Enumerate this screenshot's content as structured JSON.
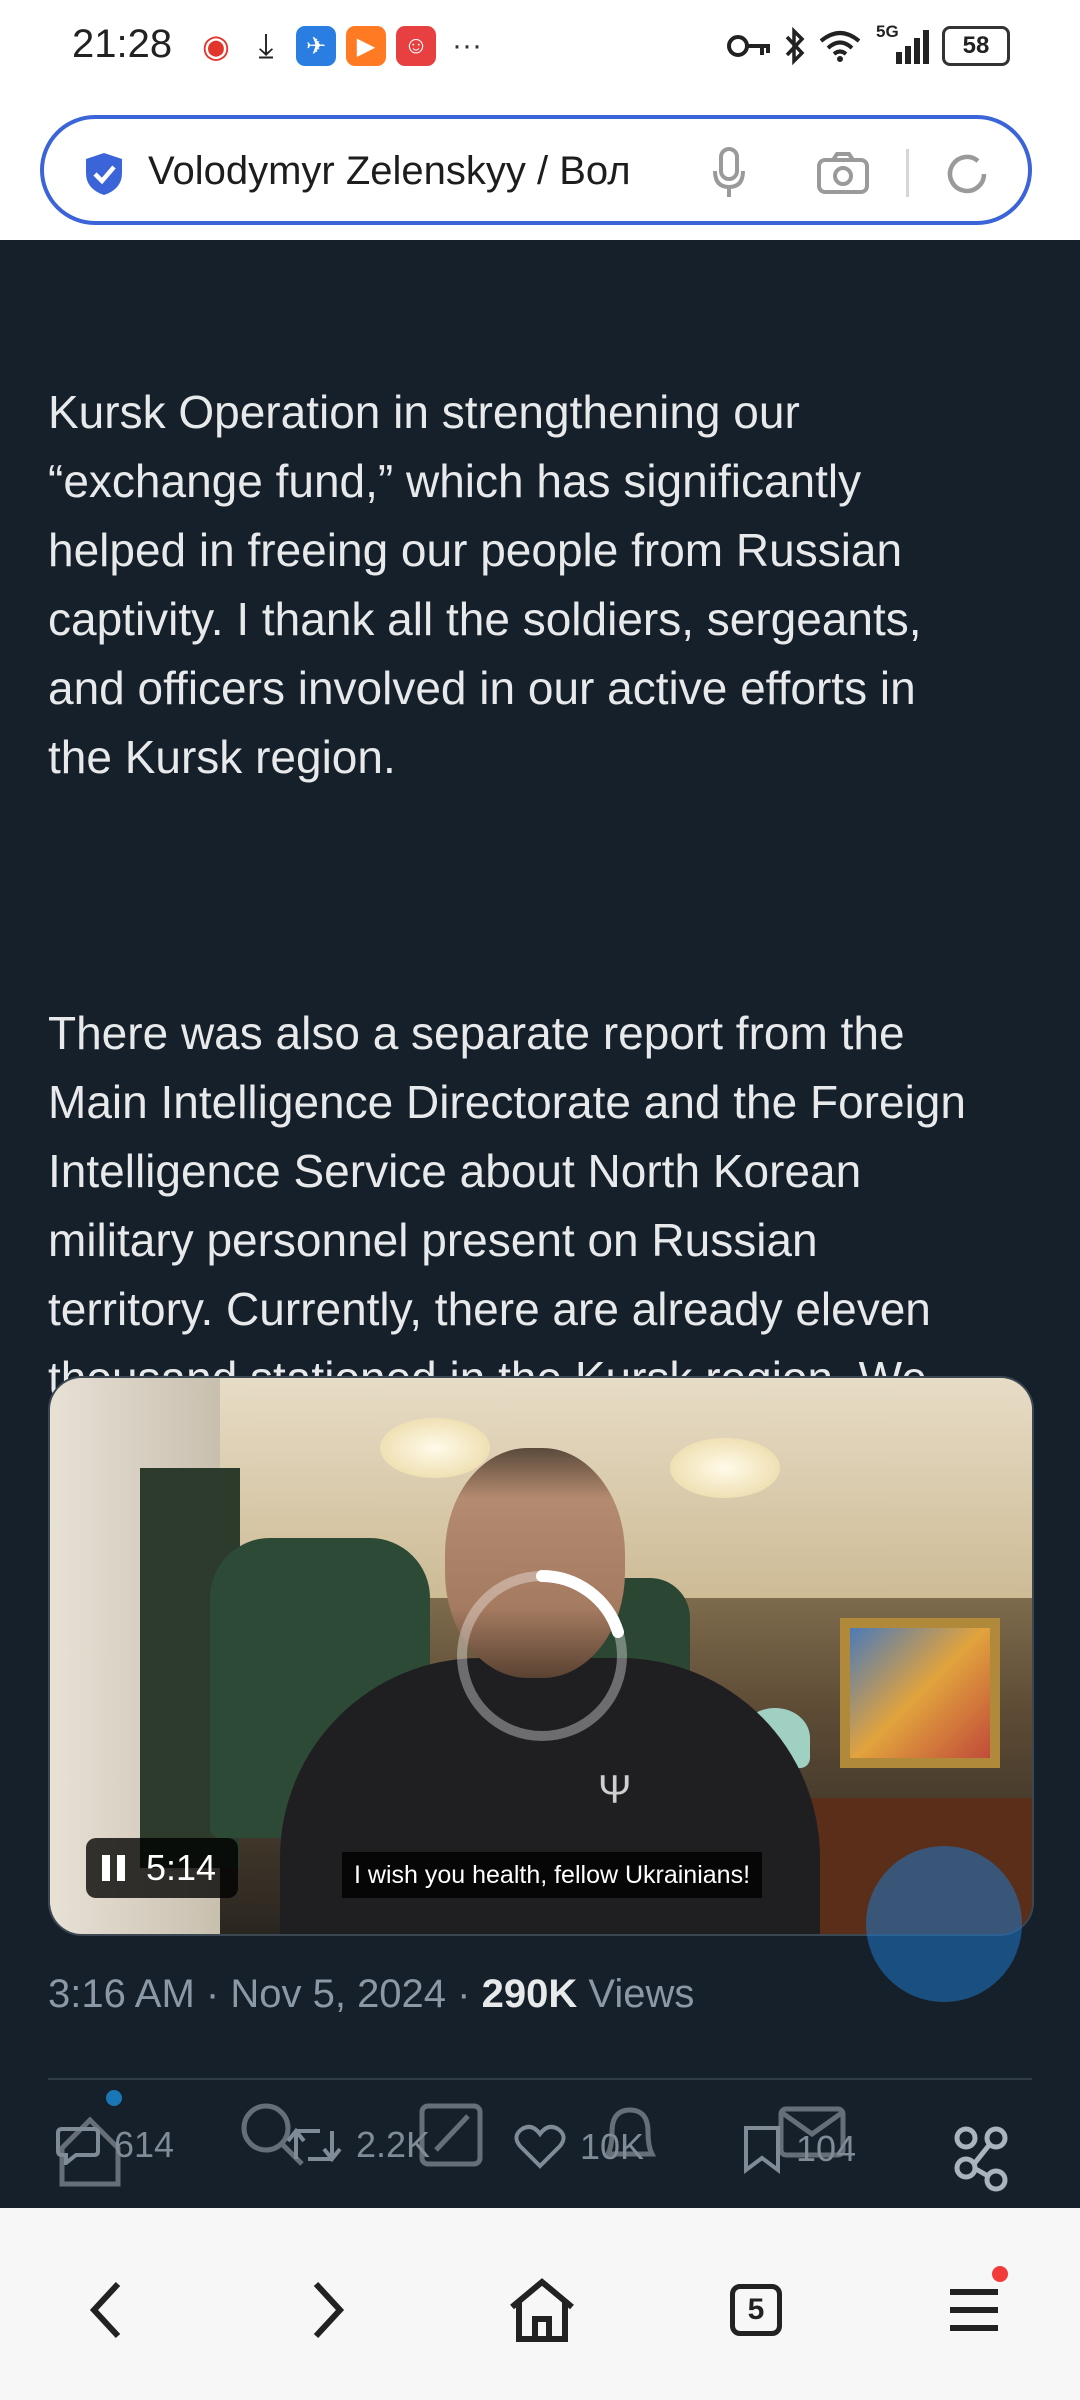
{
  "status_bar": {
    "time": "21:28",
    "overflow": "···",
    "network": "5G",
    "battery": "58"
  },
  "address_bar": {
    "title": "Volodymyr Zelenskyy / Вол"
  },
  "tweet": {
    "paragraph_1": "Kursk Operation in strengthening our\n“exchange fund,” which has significantly\nhelped in freeing our people from Russian\ncaptivity. I thank all the soldiers, sergeants,\nand officers involved in our active efforts in\nthe Kursk region.",
    "paragraph_2": "There was also a separate report from the\nMain Intelligence Directorate and the Foreign\nIntelligence Service about North Korean\nmilitary personnel present on Russian\nterritory. Currently, there are already eleven\nthousand stationed in the Kursk region. We\nsee an increase in North Korean forces, but,\nunfortunately, we do not see an increase in\nresponse from our partners."
  },
  "video": {
    "duration": "5:14",
    "subtitle": "I wish you health, fellow Ukrainians!"
  },
  "meta": {
    "time": "3:16 AM",
    "separator": "·",
    "date": "Nov 5, 2024",
    "views_count": "290K",
    "views_label": "Views"
  },
  "actions": {
    "replies": "614",
    "reposts": "2.2K",
    "likes": "10K",
    "bookmarks": "104"
  },
  "bottom_nav": {
    "tabs": "5"
  },
  "colors": {
    "background": "#16202b",
    "accent": "#3a64d8",
    "muted_text": "#8b98a5"
  }
}
